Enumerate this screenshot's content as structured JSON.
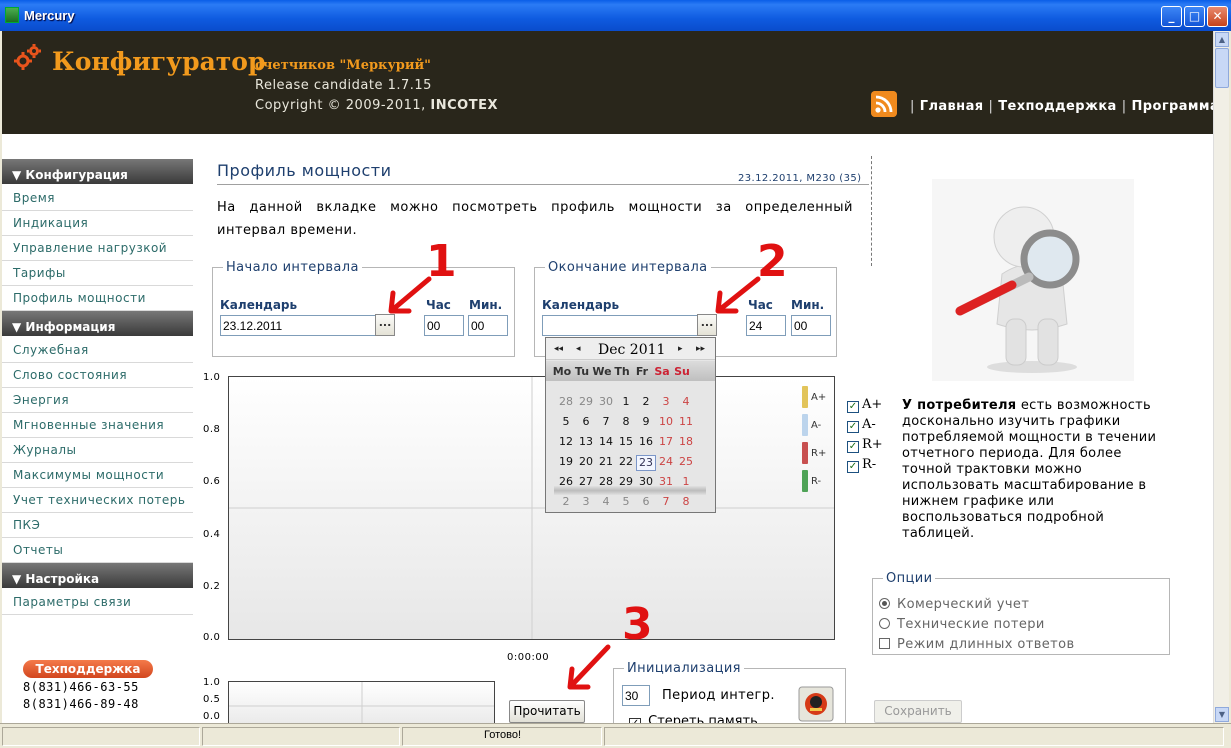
{
  "window": {
    "title": "Mercury"
  },
  "header": {
    "brand": "Конфигуратор",
    "subbrand": "счетчиков \"Меркурий\"",
    "release": "Release candidate 1.7.15",
    "copyright_prefix": "Copyright © 2009-2011, ",
    "copyright_company": "INCOTEX",
    "nav": [
      "Главная",
      "Техподдержка",
      "Программа"
    ]
  },
  "sidebar": {
    "sections": [
      {
        "title": "▼ Конфигурация",
        "items": [
          "Время",
          "Индикация",
          "Управление нагрузкой",
          "Тарифы",
          "Профиль мощности"
        ]
      },
      {
        "title": "▼ Информация",
        "items": [
          "Служебная",
          "Слово состояния",
          "Энергия",
          "Мгновенные значения",
          "Журналы",
          "Максимумы мощности",
          "Учет технических потерь",
          "ПКЭ",
          "Отчеты"
        ]
      },
      {
        "title": "▼ Настройка",
        "items": [
          "Параметры связи"
        ]
      }
    ],
    "support_label": "Техподдержка",
    "phones": [
      "8(831)466-63-55",
      "8(831)466-89-48"
    ]
  },
  "main": {
    "title": "Профиль мощности",
    "date_meta": "23.12.2011, М230 (35)",
    "description": "На данной вкладке можно посмотреть профиль мощности за определенный интервал времени.",
    "start": {
      "legend": "Начало интервала",
      "calendar_label": "Календарь",
      "date_value": "23.12.2011",
      "hour_label": "Час",
      "min_label": "Мин.",
      "hour_value": "00",
      "min_value": "00",
      "picker_label": "..."
    },
    "end": {
      "legend": "Окончание интервала",
      "calendar_label": "Календарь",
      "date_value": "",
      "hour_label": "Час",
      "min_label": "Мин.",
      "hour_value": "24",
      "min_value": "00",
      "picker_label": "..."
    },
    "calendar": {
      "month_label": "Dec 2011",
      "nav": [
        "◂◂",
        "◂",
        "▸",
        "▸▸"
      ],
      "weekdays": [
        "Mo",
        "Tu",
        "We",
        "Th",
        "Fr",
        "Sa",
        "Su"
      ],
      "weeks": [
        [
          "28",
          "29",
          "30",
          "1",
          "2",
          "3",
          "4"
        ],
        [
          "5",
          "6",
          "7",
          "8",
          "9",
          "10",
          "11"
        ],
        [
          "12",
          "13",
          "14",
          "15",
          "16",
          "17",
          "18"
        ],
        [
          "19",
          "20",
          "21",
          "22",
          "23",
          "24",
          "25"
        ],
        [
          "26",
          "27",
          "28",
          "29",
          "30",
          "31",
          "1"
        ],
        [
          "2",
          "3",
          "4",
          "5",
          "6",
          "7",
          "8"
        ]
      ],
      "today": "23"
    },
    "chart": {
      "y_ticks": [
        "1.0",
        "0.8",
        "0.6",
        "0.4",
        "0.2",
        "0.0"
      ],
      "x_label": "0:00:00",
      "legend": [
        {
          "label": "A+",
          "color": "#e2c45a"
        },
        {
          "label": "A-",
          "color": "#bcd4ec"
        },
        {
          "label": "R+",
          "color": "#c85050"
        },
        {
          "label": "R-",
          "color": "#4fa357"
        }
      ]
    },
    "mini_chart": {
      "y_ticks": [
        "1.0",
        "0.5",
        "0.0"
      ]
    },
    "series_toggles": [
      {
        "label": "A+",
        "checked": true
      },
      {
        "label": "A-",
        "checked": true
      },
      {
        "label": "R+",
        "checked": true
      },
      {
        "label": "R-",
        "checked": true
      }
    ],
    "info_bold": "У потребителя",
    "info_text": " есть возможность досконально изучить графики потребляемой мощности в течении отчетного периода. Для более точной трактовки можно использовать масштабирование в нижнем графике или воспользоваться подробной таблицей.",
    "options": {
      "legend": "Опции",
      "items": [
        "Комерческий учет",
        "Технические потери",
        "Режим длинных ответов"
      ]
    },
    "read_button": "Прочитать",
    "init": {
      "legend": "Инициализация",
      "period_value": "30",
      "period_label": "Период интегр.",
      "clear_label": "Стереть память"
    },
    "save_button": "Сохранить",
    "annotations": [
      "1",
      "2",
      "3"
    ]
  },
  "status": {
    "text": "Готово!"
  },
  "colors": {
    "header_bg": "#29261b",
    "brand": "#f29a1d",
    "link": "#2c6b69",
    "title": "#1e3f6e",
    "annotation": "#e01111"
  }
}
